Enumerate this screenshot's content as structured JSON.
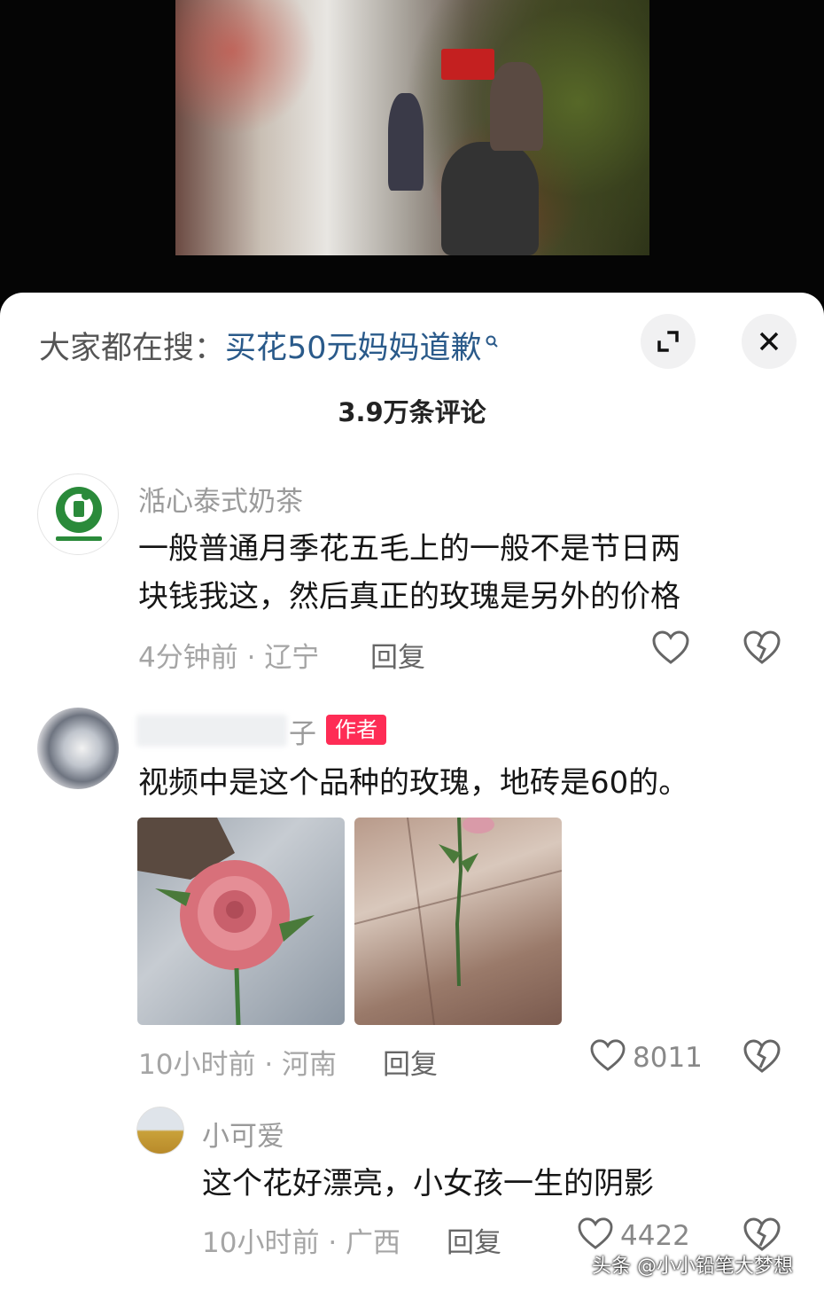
{
  "header": {
    "search_prefix": "大家都在搜：",
    "search_term": "买花50元妈妈道歉",
    "comment_count": "3.9万条评论"
  },
  "comments": [
    {
      "name": "湉心泰式奶茶",
      "avatar_text": "湉心泰式奶茶",
      "text_line1": "一般普通月季花五毛上的一般不是节日两",
      "text_line2": "块钱我这，然后真正的玫瑰是另外的价格",
      "time": "4分钟前",
      "location": "辽宁",
      "reply_label": "回复"
    },
    {
      "name_visible": "子",
      "author_badge": "作者",
      "text": "视频中是这个品种的玫瑰，地砖是60的。",
      "time": "10小时前",
      "location": "河南",
      "reply_label": "回复",
      "likes": "8011"
    },
    {
      "name": "小可爱",
      "text": "这个花好漂亮，小女孩一生的阴影",
      "time": "10小时前",
      "location": "广西",
      "reply_label": "回复",
      "likes": "4422"
    }
  ],
  "watermark": "头条 @小小铅笔大梦想",
  "colors": {
    "search_term": "#2a5a8a",
    "author_badge": "#fe2c55",
    "avatar_brand": "#2a8a3a"
  },
  "icons": [
    "search-icon",
    "expand-icon",
    "close-icon",
    "heart-icon",
    "broken-heart-icon"
  ]
}
